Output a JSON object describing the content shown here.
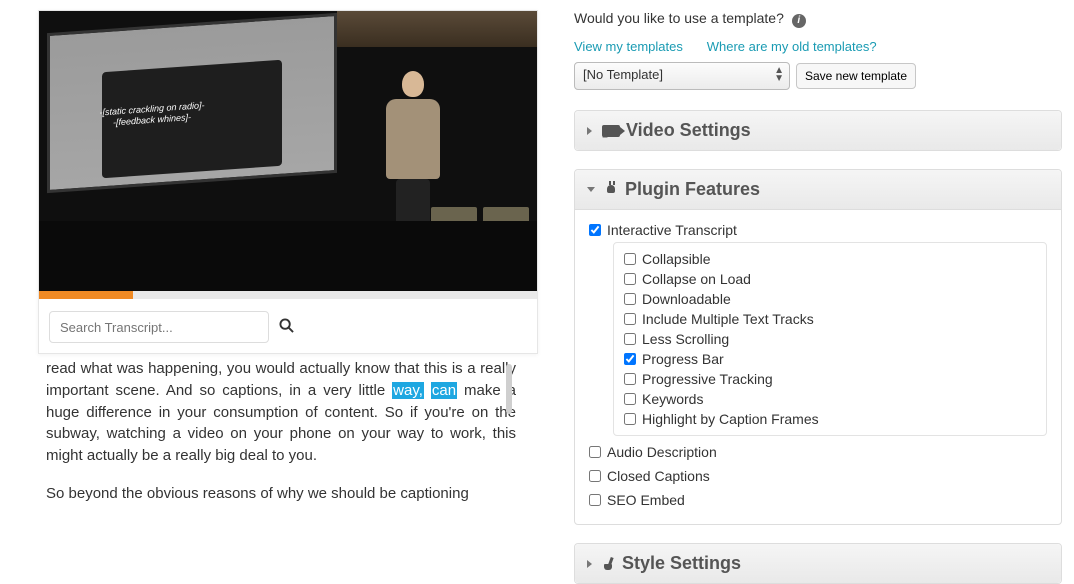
{
  "template": {
    "prompt": "Would you like to use a template?",
    "view_link": "View my templates",
    "where_link": "Where are my old templates?",
    "selected": "[No Template]",
    "save_btn": "Save new template"
  },
  "panels": {
    "video_settings": "Video Settings",
    "plugin_features": "Plugin Features",
    "style_settings": "Style Settings"
  },
  "features": {
    "interactive_transcript": {
      "label": "Interactive Transcript",
      "checked": true
    },
    "sub": [
      {
        "label": "Collapsible",
        "checked": false
      },
      {
        "label": "Collapse on Load",
        "checked": false
      },
      {
        "label": "Downloadable",
        "checked": false
      },
      {
        "label": "Include Multiple Text Tracks",
        "checked": false
      },
      {
        "label": "Less Scrolling",
        "checked": false
      },
      {
        "label": "Progress Bar",
        "checked": true
      },
      {
        "label": "Progressive Tracking",
        "checked": false
      },
      {
        "label": "Keywords",
        "checked": false
      },
      {
        "label": "Highlight by Caption Frames",
        "checked": false
      }
    ],
    "audio_description": {
      "label": "Audio Description",
      "checked": false
    },
    "closed_captions": {
      "label": "Closed Captions",
      "checked": false
    },
    "seo_embed": {
      "label": "SEO Embed",
      "checked": false
    }
  },
  "video": {
    "caption_line1": "-[static crackling on radio]-",
    "caption_line2": "-[feedback whines]-"
  },
  "search": {
    "placeholder": "Search Transcript..."
  },
  "transcript": {
    "pre": "read what was happening, you would actually know that this is a really important scene. And so captions, in a very little ",
    "hl1": "way,",
    "hl2": "can",
    "post": " make a huge difference in your consumption of content. So if you're on the subway, watching a video on your phone on your way to work, this might actually be a really big deal to you.",
    "para2": "So beyond the obvious reasons of why we should be captioning"
  }
}
